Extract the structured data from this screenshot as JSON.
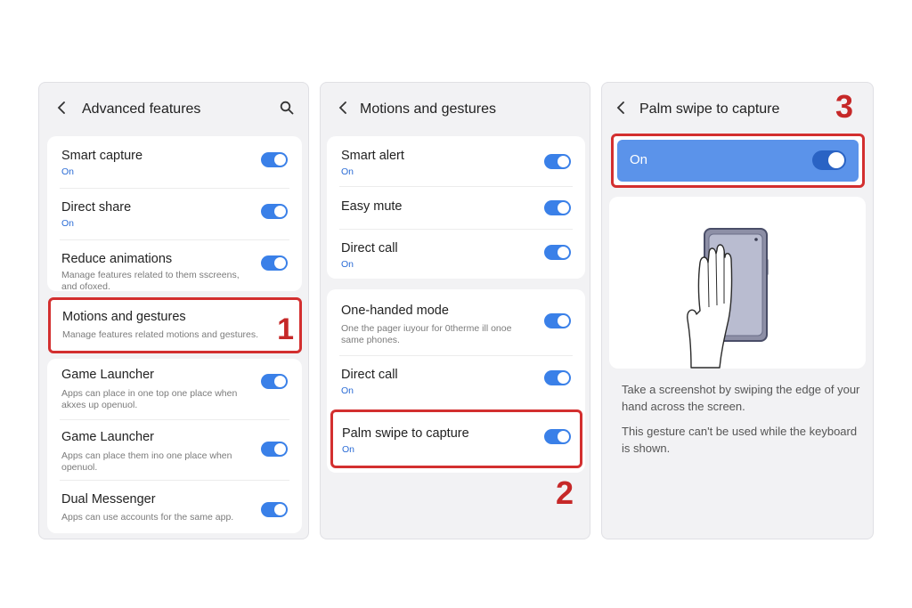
{
  "panel1": {
    "title": "Advanced features",
    "items": [
      {
        "title": "Smart capture",
        "status": "On"
      },
      {
        "title": "Direct share",
        "status": "On"
      },
      {
        "title": "Reduce animations",
        "subtitle": "Manage features related to them sscreens, and ofoxed."
      },
      {
        "title": "Motions and gestures",
        "subtitle": "Manage features related motions and gestures."
      },
      {
        "title": "Game Launcher",
        "subtitle": "Apps can place in one top one place when akxes up openuol."
      },
      {
        "title": "Game Launcher",
        "subtitle": "Apps can place them ino one place when openuol."
      },
      {
        "title": "Dual Messenger",
        "subtitle": "Apps can use accounts for the same app."
      }
    ],
    "step": "1"
  },
  "panel2": {
    "title": "Motions and gestures",
    "items": [
      {
        "title": "Smart alert",
        "status": "On"
      },
      {
        "title": "Easy mute"
      },
      {
        "title": "Direct call",
        "status": "On"
      },
      {
        "title": "One-handed mode",
        "subtitle": "One the pager iuyour for 0therme ill onoe same phones."
      },
      {
        "title": "Direct call",
        "status": "On"
      },
      {
        "title": "Palm swipe to capture",
        "status": "On"
      }
    ],
    "step": "2"
  },
  "panel3": {
    "title": "Palm swipe to capture",
    "toggle_label": "On",
    "description1": "Take a screenshot by swiping the edge of your hand across the screen.",
    "description2": "This gesture can't be used while the keyboard is shown.",
    "step": "3"
  },
  "icons": [
    "back-icon",
    "search-icon",
    "toggle-on",
    "palm-swipe-illustration"
  ],
  "colors": {
    "accent": "#3a80e8",
    "highlight": "#d32f2f",
    "panel_bg": "#f2f2f4"
  }
}
